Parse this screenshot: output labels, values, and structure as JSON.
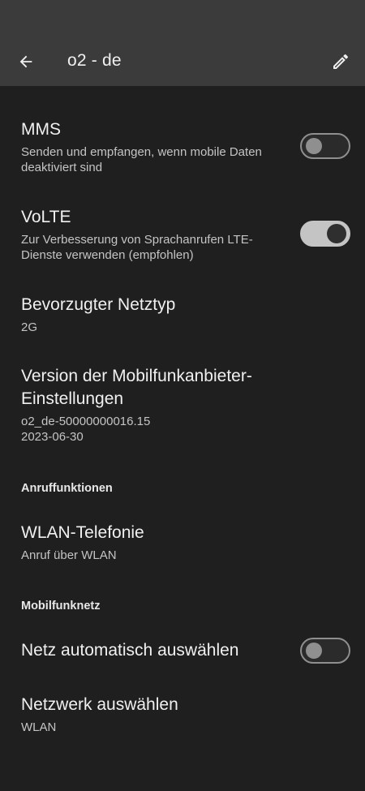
{
  "header": {
    "title": "o2 - de",
    "back_icon": "arrow-back-icon",
    "edit_icon": "pencil-icon"
  },
  "items": {
    "mms": {
      "title": "MMS",
      "summary": "Senden und empfangen, wenn mobile Daten deaktiviert sind",
      "enabled": false
    },
    "volte": {
      "title": "VoLTE",
      "summary": "Zur Verbesserung von Sprachanrufen LTE-Dienste verwenden (empfohlen)",
      "enabled": true
    },
    "network_type": {
      "title": "Bevorzugter Netztyp",
      "summary": "2G"
    },
    "carrier_version": {
      "title": "Version der Mobilfunkanbieter-Einstellungen",
      "summary_line1": "o2_de-50000000016.15",
      "summary_line2": "2023-06-30"
    },
    "wifi_calling": {
      "title": "WLAN-Telefonie",
      "summary": "Anruf über WLAN"
    },
    "auto_network": {
      "title": "Netz automatisch auswählen",
      "enabled": false
    },
    "select_network": {
      "title": "Netzwerk auswählen",
      "summary": "WLAN"
    }
  },
  "sections": {
    "call_features": "Anruffunktionen",
    "mobile_network": "Mobilfunknetz"
  },
  "colors": {
    "background": "#1f1f1f",
    "app_bar": "#3b3b3b",
    "switch_on": "#c4c4c4",
    "switch_off_border": "#8f8f8f"
  }
}
